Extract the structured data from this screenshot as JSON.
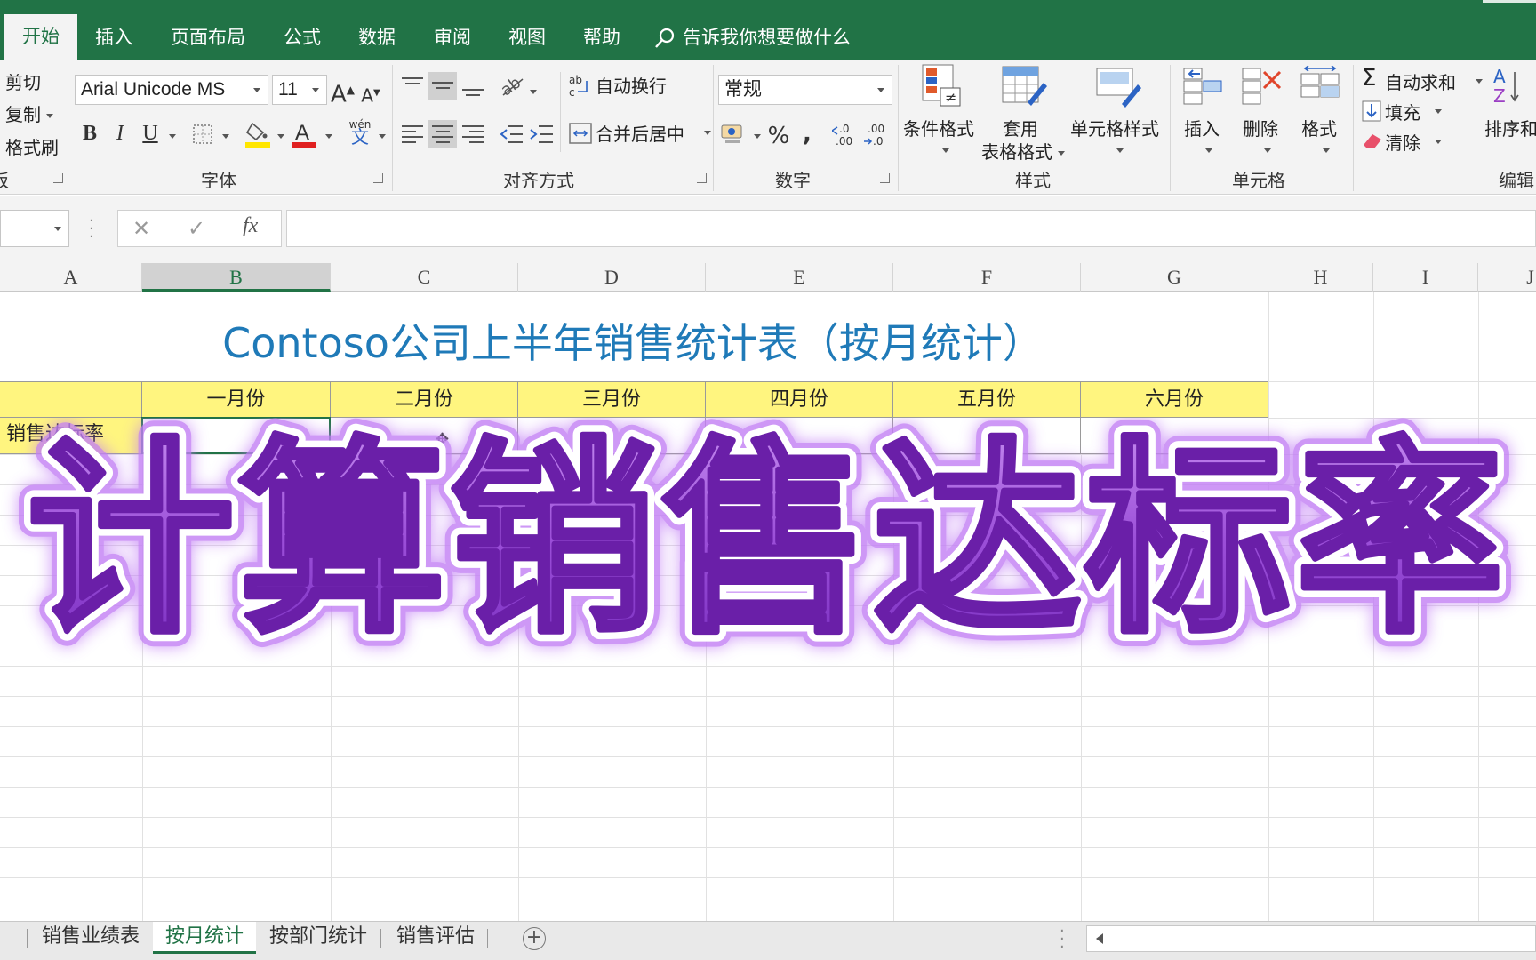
{
  "ribbon_tabs": [
    "开始",
    "插入",
    "页面布局",
    "公式",
    "数据",
    "审阅",
    "视图",
    "帮助"
  ],
  "tell_me": "告诉我你想要做什么",
  "clipboard": {
    "cut": "剪切",
    "copy": "复制",
    "format_painter": "格式刷",
    "group_label_fragment": "板"
  },
  "font": {
    "name": "Arial Unicode MS",
    "size": "11",
    "group_label": "字体",
    "phonetic_label": "wén",
    "phonetic_char": "文"
  },
  "alignment": {
    "wrap": "自动换行",
    "merge": "合并后居中",
    "group_label": "对齐方式"
  },
  "number": {
    "format": "常规",
    "group_label": "数字"
  },
  "styles": {
    "conditional": "条件格式",
    "table_line1": "套用",
    "table_line2": "表格格式",
    "cell_styles": "单元格样式",
    "group_label": "样式"
  },
  "cells": {
    "insert": "插入",
    "delete": "删除",
    "format": "格式",
    "group_label": "单元格"
  },
  "editing": {
    "autosum": "自动求和",
    "fill": "填充",
    "clear": "清除",
    "sort": "排序和",
    "group_label": "编辑"
  },
  "formula_bar": {
    "cancel": "✕",
    "enter": "✓",
    "fx": "fx",
    "value": ""
  },
  "columns": [
    "A",
    "B",
    "C",
    "D",
    "E",
    "F",
    "G",
    "H",
    "I",
    "J"
  ],
  "selected_column": "B",
  "sheet": {
    "title": "Contoso公司上半年销售统计表（按月统计）",
    "row_label": "销售达标率",
    "months": [
      "一月份",
      "二月份",
      "三月份",
      "四月份",
      "五月份",
      "六月份"
    ]
  },
  "overlay_text": "计算销售达标率",
  "sheet_tabs": [
    "销售业绩表",
    "按月统计",
    "按部门统计",
    "销售评估"
  ],
  "active_sheet": "按月统计",
  "colors": {
    "excel_green": "#217346",
    "title_blue": "#1f7ab8",
    "header_yellow": "#fff57f",
    "overlay_purple": "#8a3fd0"
  }
}
